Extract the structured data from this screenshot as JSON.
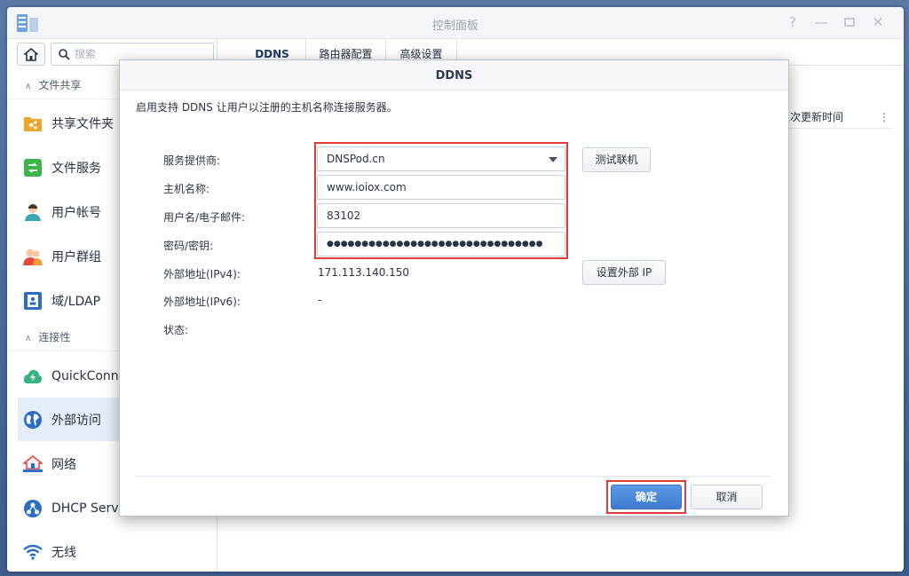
{
  "window": {
    "title": "控制面板"
  },
  "sidebar": {
    "search_placeholder": "搜索",
    "sections": [
      {
        "label": "文件共享"
      },
      {
        "label": "连接性"
      }
    ],
    "items": [
      {
        "label": "共享文件夹"
      },
      {
        "label": "文件服务"
      },
      {
        "label": "用户帐号"
      },
      {
        "label": "用户群组"
      },
      {
        "label": "域/LDAP"
      },
      {
        "label": "QuickConnect"
      },
      {
        "label": "外部访问"
      },
      {
        "label": "网络"
      },
      {
        "label": "DHCP Server"
      },
      {
        "label": "无线"
      }
    ]
  },
  "main": {
    "tabs": [
      {
        "label": "DDNS"
      },
      {
        "label": "路由器配置"
      },
      {
        "label": "高级设置"
      }
    ],
    "column_header": "上次更新时间"
  },
  "dialog": {
    "title": "DDNS",
    "description": "启用支持 DDNS 让用户以注册的主机名称连接服务器。",
    "fields": {
      "provider": {
        "label": "服务提供商:",
        "value": "DNSPod.cn"
      },
      "hostname": {
        "label": "主机名称:",
        "value": "www.ioiox.com"
      },
      "username": {
        "label": "用户名/电子邮件:",
        "value": "83102"
      },
      "password": {
        "label": "密码/密钥:",
        "value": "●●●●●●●●●●●●●●●●●●●●●●●●●●●●●●●"
      },
      "ipv4": {
        "label": "外部地址(IPv4):",
        "value": "171.113.140.150"
      },
      "ipv6": {
        "label": "外部地址(IPv6):",
        "value": "-"
      },
      "status": {
        "label": "状态:",
        "value": ""
      }
    },
    "buttons": {
      "test": "测试联机",
      "set_ip": "设置外部 IP",
      "ok": "确定",
      "cancel": "取消"
    }
  },
  "colors": {
    "accent": "#3c7bd0",
    "highlight": "#e23b36",
    "active_item": "#e4edf8"
  }
}
